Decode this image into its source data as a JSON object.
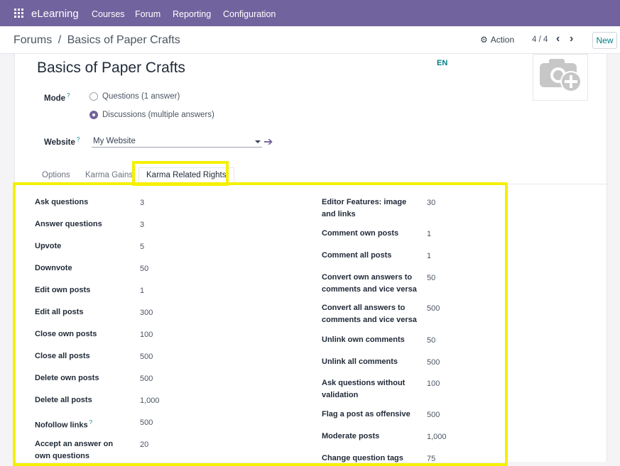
{
  "navbar": {
    "brand": "eLearning",
    "menu": [
      "Courses",
      "Forum",
      "Reporting",
      "Configuration"
    ]
  },
  "control_panel": {
    "breadcrumb_parent": "Forums",
    "breadcrumb_separator": "/",
    "breadcrumb_current": "Basics of Paper Crafts",
    "action_label": "Action",
    "pager": "4 / 4",
    "new_label": "New"
  },
  "form": {
    "title": "Basics of Paper Crafts",
    "lang": "EN",
    "mode_label": "Mode",
    "mode_options": [
      "Questions (1 answer)",
      "Discussions (multiple answers)"
    ],
    "mode_selected": "Discussions (multiple answers)",
    "website_label": "Website",
    "website_value": "My Website",
    "help_mark": "?"
  },
  "tabs": [
    "Options",
    "Karma Gains",
    "Karma Related Rights"
  ],
  "active_tab": "Karma Related Rights",
  "karma_left": [
    {
      "label": "Ask questions",
      "value": "3"
    },
    {
      "label": "Answer questions",
      "value": "3"
    },
    {
      "label": "Upvote",
      "value": "5"
    },
    {
      "label": "Downvote",
      "value": "50"
    },
    {
      "label": "Edit own posts",
      "value": "1"
    },
    {
      "label": "Edit all posts",
      "value": "300"
    },
    {
      "label": "Close own posts",
      "value": "100"
    },
    {
      "label": "Close all posts",
      "value": "500"
    },
    {
      "label": "Delete own posts",
      "value": "500"
    },
    {
      "label": "Delete all posts",
      "value": "1,000"
    },
    {
      "label": "Nofollow links",
      "value": "500",
      "help": "?"
    },
    {
      "label": "Accept an answer on own questions",
      "value": "20"
    }
  ],
  "karma_right": [
    {
      "label": "Editor Features: image and links",
      "value": "30"
    },
    {
      "label": "Comment own posts",
      "value": "1"
    },
    {
      "label": "Comment all posts",
      "value": "1"
    },
    {
      "label": "Convert own answers to comments and vice versa",
      "value": "50"
    },
    {
      "label": "Convert all answers to comments and vice versa",
      "value": "500"
    },
    {
      "label": "Unlink own comments",
      "value": "50"
    },
    {
      "label": "Unlink all comments",
      "value": "500"
    },
    {
      "label": "Ask questions without validation",
      "value": "100"
    },
    {
      "label": "Flag a post as offensive",
      "value": "500"
    },
    {
      "label": "Moderate posts",
      "value": "1,000"
    },
    {
      "label": "Change question tags",
      "value": "75"
    }
  ],
  "colors": {
    "brand": "#71639e",
    "accent": "#017e84",
    "highlight": "#f5f000"
  }
}
